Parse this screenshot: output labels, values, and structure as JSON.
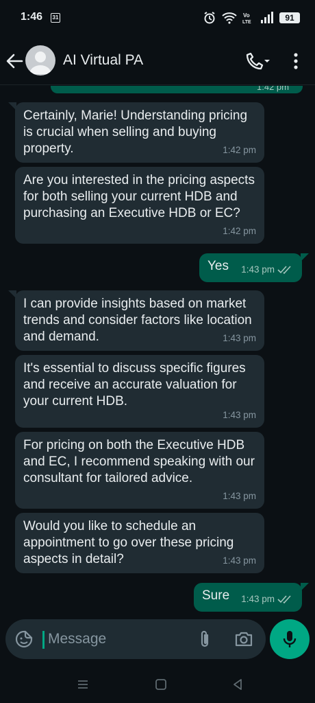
{
  "status_bar": {
    "time": "1:46",
    "calendar_badge": "31",
    "battery": "91"
  },
  "header": {
    "title": "AI Virtual PA"
  },
  "chat": {
    "partial_top_time": "1:42 pm",
    "messages": [
      {
        "direction": "incoming",
        "text": "Certainly, Marie! Understanding pricing is crucial when selling and buying property.",
        "time": "1:42 pm"
      },
      {
        "direction": "incoming",
        "text": "Are you interested in the pricing aspects for both selling your current HDB and purchasing an Executive HDB or EC?",
        "time": "1:42 pm"
      },
      {
        "direction": "outgoing",
        "text": "Yes",
        "time": "1:43 pm"
      },
      {
        "direction": "incoming",
        "text": "I can provide insights based on market trends and consider factors like location and demand.",
        "time": "1:43 pm"
      },
      {
        "direction": "incoming",
        "text": "It's essential to discuss specific figures and receive an accurate valuation for your current HDB.",
        "time": "1:43 pm"
      },
      {
        "direction": "incoming",
        "text": "For pricing on both the Executive HDB and EC, I recommend speaking with our consultant for tailored advice.",
        "time": "1:43 pm"
      },
      {
        "direction": "incoming",
        "text": "Would you like to schedule an appointment to go over these pricing aspects in detail?",
        "time": "1:43 pm"
      },
      {
        "direction": "outgoing",
        "text": "Sure",
        "time": "1:43 pm"
      }
    ]
  },
  "input": {
    "placeholder": "Message"
  },
  "colors": {
    "background": "#0b1014",
    "incoming_bubble": "#202c33",
    "outgoing_bubble": "#005c4b",
    "accent": "#00a884"
  },
  "icons": [
    "back-arrow-icon",
    "avatar-icon",
    "phone-icon",
    "more-vert-icon",
    "emoji-icon",
    "attach-icon",
    "camera-icon",
    "mic-icon",
    "double-check-icon"
  ]
}
